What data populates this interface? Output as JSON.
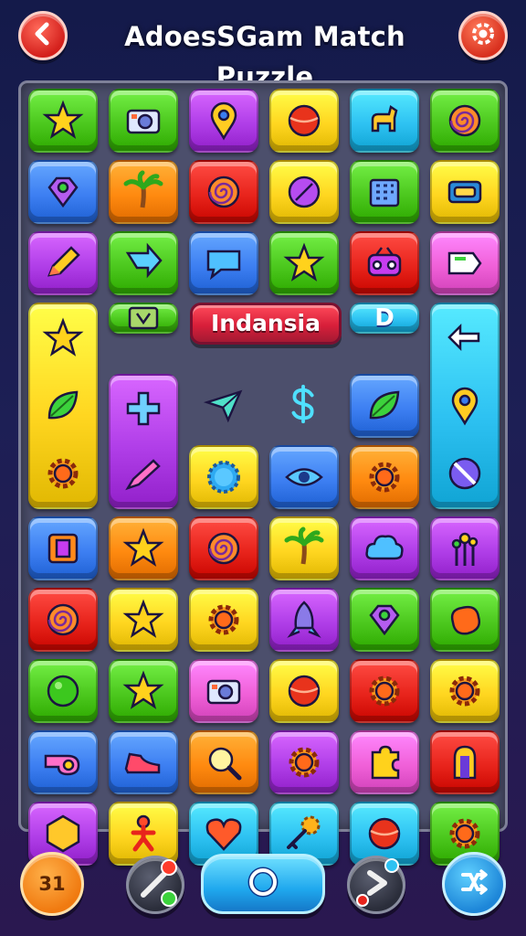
{
  "header": {
    "title": "AdoesSGam Match Puzzle",
    "back_icon": "chevron-left-icon",
    "settings_icon": "gear-icon"
  },
  "board": {
    "banner_text": "Indansia",
    "label_tile_text": "D",
    "colors": {
      "green": "#4cc81e",
      "blue": "#3d7ff2",
      "purple": "#b03ee8",
      "yellow": "#ffd620",
      "orange": "#ff8a10",
      "red": "#e8241c",
      "cyan": "#2ec2f2",
      "pink": "#f060d8"
    },
    "rows": [
      [
        "green:star",
        "green:camera",
        "purple:map-pin",
        "yellow:ball",
        "cyan:dog",
        "green:spiral"
      ],
      [
        "blue:gem",
        "orange:palm-tree",
        "red:spiral",
        "yellow:compass",
        "green:building",
        "yellow:tape"
      ],
      [
        "purple:pencil",
        "green:arrow",
        "blue:speech-bubble",
        "green:star",
        "red:radio",
        "pink:tag"
      ],
      [
        "yellow:star",
        "green:tv",
        "banner",
        "",
        "cyan:D",
        "cyan:arrow-back"
      ],
      [
        "yellow:leaf",
        "purple:plus",
        "free:paper-plane",
        "free:dollar",
        "blue:leaf",
        "cyan:map-pin"
      ],
      [
        "yellow:gear",
        "blue:pen",
        "yellow:sun",
        "blue:eye",
        "orange:gear",
        "cyan:no-sign"
      ],
      [
        "blue:book",
        "orange:star",
        "red:spiral",
        "yellow:palm-tree",
        "purple:cloud",
        "purple:flower"
      ],
      [
        "red:spiral",
        "yellow:star",
        "yellow:gear",
        "purple:rocket",
        "green:gem",
        "green:blob"
      ],
      [
        "green:circle",
        "green:star",
        "pink:camera",
        "yellow:ball",
        "red:gear",
        "yellow:gear"
      ],
      [
        "blue:whistle",
        "blue:shoe",
        "orange:magnifier",
        "purple:gear",
        "pink:puzzle",
        "red:door"
      ],
      [
        "purple:hexagon",
        "yellow:person",
        "cyan:heart",
        "cyan:key",
        "cyan:ball",
        "green:gear"
      ]
    ]
  },
  "bottom_bar": {
    "counter_label": "31",
    "hint_icon": "wand-icon",
    "play_icon": "ring-icon",
    "next_icon": "play-arrow-icon",
    "shuffle_icon": "shuffle-icon"
  }
}
